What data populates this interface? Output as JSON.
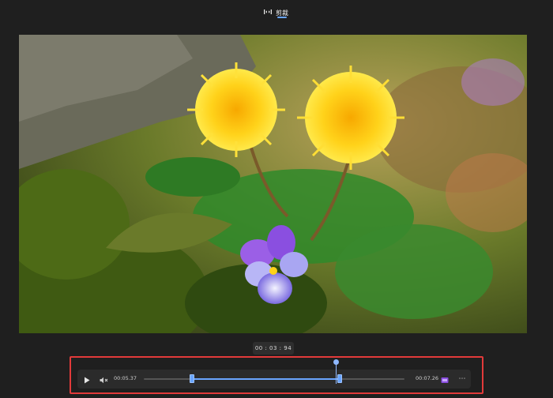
{
  "tab": {
    "label": "剪裁",
    "icon": "trim-icon"
  },
  "video": {
    "description_icon": "video-frame"
  },
  "current_time": "00 : 03 : 94",
  "controls": {
    "play_icon": "play-icon",
    "mute_icon": "mute-icon",
    "start_time": "00:05.37",
    "end_time": "00:07.26",
    "clip_icon": "clip-icon",
    "more_label": "⋯"
  },
  "colors": {
    "accent": "#6aa5ff",
    "highlight": "#e23a3a",
    "background": "#1f1f1f"
  }
}
